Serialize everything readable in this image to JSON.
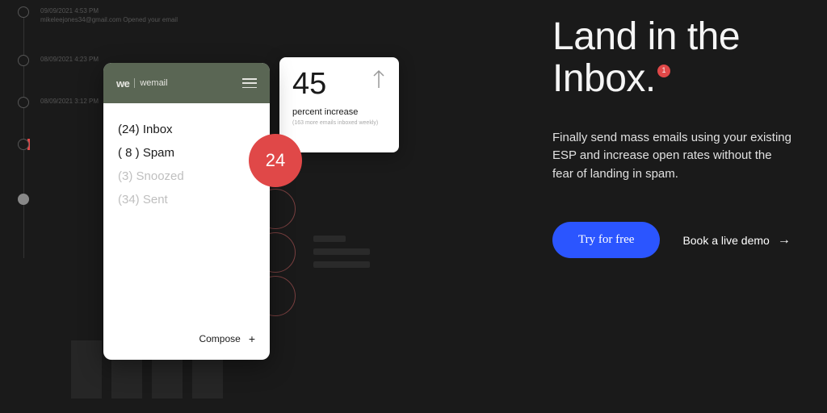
{
  "timeline": {
    "items": [
      {
        "date": "09/09/2021 4:53 PM",
        "detail": "mikeleejones34@gmail.com Opened your email"
      },
      {
        "date": "08/09/2021 4:23 PM",
        "detail": ""
      },
      {
        "date": "08/09/2021 3:12 PM",
        "detail": ""
      },
      {
        "date": "",
        "detail": ""
      },
      {
        "date": "",
        "detail": ""
      }
    ]
  },
  "phone": {
    "logo_mark": "we",
    "logo_name": "wemail",
    "folders": [
      {
        "label": "(24) Inbox",
        "dim": false
      },
      {
        "label": "( 8 ) Spam",
        "dim": false
      },
      {
        "label": "(3) Snoozed",
        "dim": true
      },
      {
        "label": "(34) Sent",
        "dim": true
      }
    ],
    "compose": "Compose"
  },
  "badge": "24",
  "stat": {
    "number": "45",
    "label": "percent increase",
    "small": "(163 more emails inboxed weekly)"
  },
  "hero": {
    "headline_l1": "Land in the",
    "headline_l2": "Inbox.",
    "super": "1",
    "sub": "Finally send mass emails using your existing ESP and increase open rates without the fear of landing in spam.",
    "cta_primary": "Try for free",
    "cta_secondary": "Book a live demo"
  }
}
